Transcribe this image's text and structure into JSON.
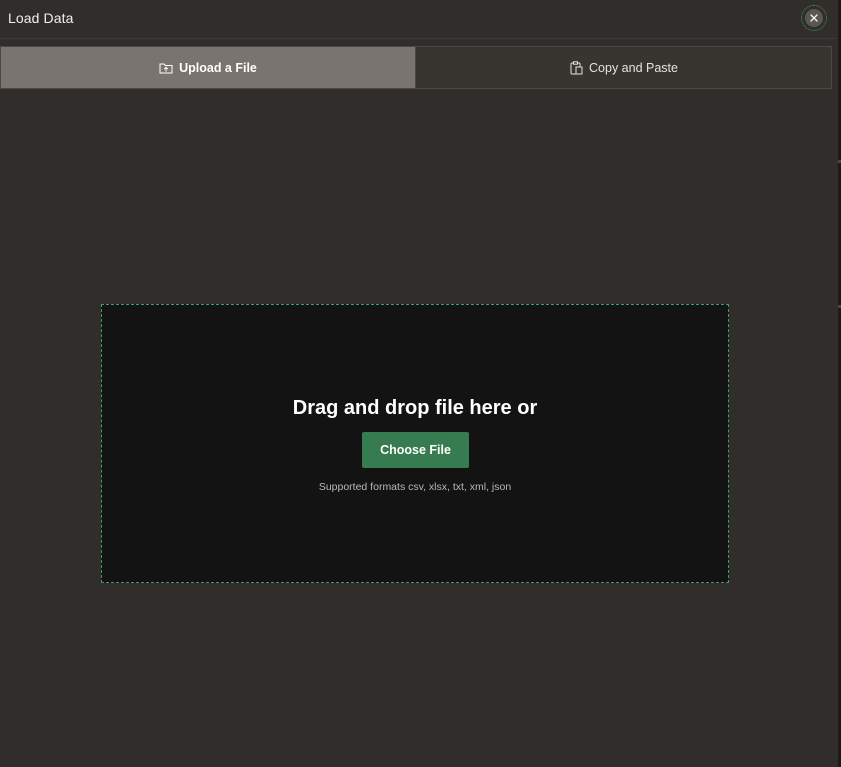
{
  "dialog": {
    "title": "Load Data"
  },
  "tabs": [
    {
      "label": "Upload a File",
      "icon": "folder-upload-icon",
      "active": true
    },
    {
      "label": "Copy and Paste",
      "icon": "clipboard-icon",
      "active": false
    }
  ],
  "dropzone": {
    "heading": "Drag and drop file here or",
    "button_label": "Choose File",
    "formats_text": "Supported formats csv, xlsx, txt, xml, json"
  },
  "colors": {
    "background": "#312d2a",
    "active_tab": "#7a7470",
    "dropzone_bg": "#131313",
    "accent": "#377b51",
    "dashed_border": "#3f9e66"
  }
}
